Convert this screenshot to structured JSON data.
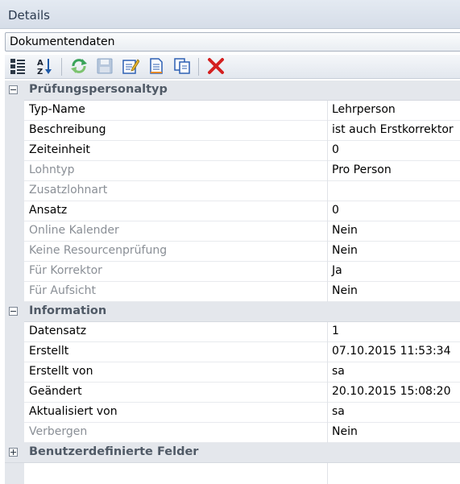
{
  "window": {
    "title": "Details"
  },
  "selector": {
    "value": "Dokumentendaten"
  },
  "toolbar": {
    "buttons": [
      {
        "icon": "categorized-view-icon",
        "color": "#2c3846"
      },
      {
        "icon": "sort-alphabetical-icon",
        "color": "#1e5aa8"
      },
      {
        "icon": "refresh-icon",
        "color": "#3aa35a"
      },
      {
        "icon": "save-icon",
        "color": "#8fa8c8"
      },
      {
        "icon": "edit-icon",
        "color": "#2c5fb3"
      },
      {
        "icon": "new-document-icon",
        "color": "#2c5fb3"
      },
      {
        "icon": "copy-icon",
        "color": "#2c5fb3"
      },
      {
        "icon": "delete-icon",
        "color": "#d42020"
      }
    ]
  },
  "categories": [
    {
      "label": "Prüfungspersonaltyp",
      "expanded": true,
      "rows": [
        {
          "name": "Typ-Name",
          "value": "Lehrperson",
          "disabled": false
        },
        {
          "name": "Beschreibung",
          "value": "ist auch Erstkorrektor",
          "disabled": false
        },
        {
          "name": "Zeiteinheit",
          "value": "0",
          "disabled": false
        },
        {
          "name": "Lohntyp",
          "value": "Pro Person",
          "disabled": true
        },
        {
          "name": "Zusatzlohnart",
          "value": "",
          "disabled": true
        },
        {
          "name": "Ansatz",
          "value": "0",
          "disabled": false
        },
        {
          "name": "Online Kalender",
          "value": "Nein",
          "disabled": true
        },
        {
          "name": "Keine Resourcenprüfung",
          "value": "Nein",
          "disabled": true
        },
        {
          "name": "Für Korrektor",
          "value": "Ja",
          "disabled": true
        },
        {
          "name": "Für Aufsicht",
          "value": "Nein",
          "disabled": true
        }
      ]
    },
    {
      "label": "Information",
      "expanded": true,
      "rows": [
        {
          "name": "Datensatz",
          "value": "1",
          "disabled": false
        },
        {
          "name": "Erstellt",
          "value": "07.10.2015 11:53:34",
          "disabled": false
        },
        {
          "name": "Erstellt von",
          "value": "sa",
          "disabled": false
        },
        {
          "name": "Geändert",
          "value": "20.10.2015 15:08:20",
          "disabled": false
        },
        {
          "name": "Aktualisiert von",
          "value": "sa",
          "disabled": false
        },
        {
          "name": "Verbergen",
          "value": "Nein",
          "disabled": true
        }
      ]
    },
    {
      "label": "Benutzerdefinierte Felder",
      "expanded": false,
      "rows": []
    }
  ]
}
